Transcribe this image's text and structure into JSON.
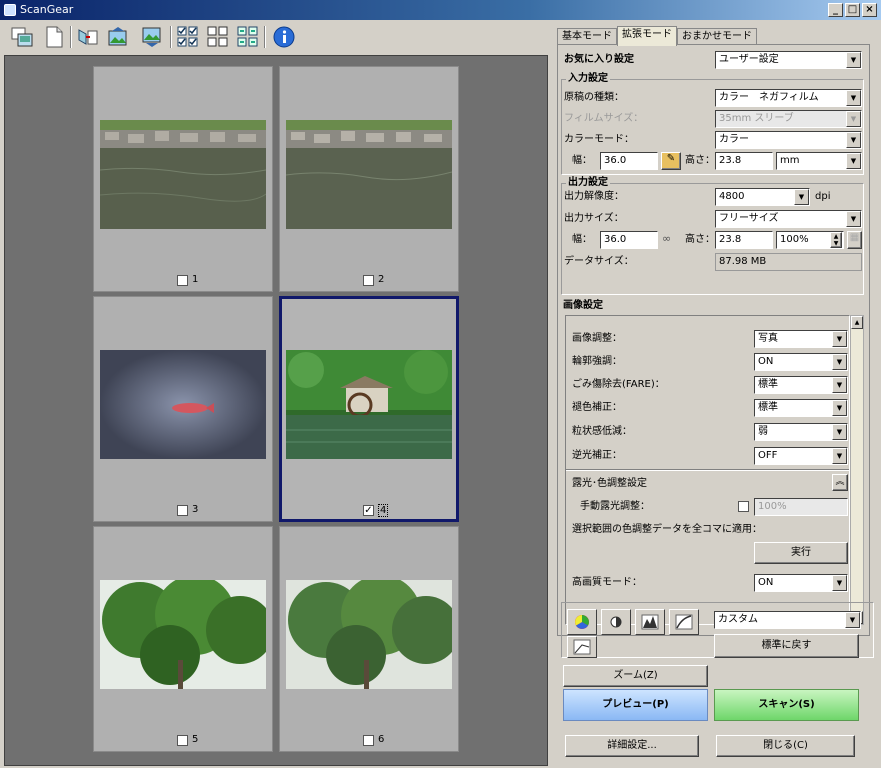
{
  "window": {
    "title": "ScanGear",
    "min": "_",
    "max": "□",
    "close": "×"
  },
  "toolbar": {
    "icons": [
      "multi-crop-icon",
      "blank-page-icon",
      "rotate-icon",
      "image-prev-icon",
      "image-next-icon",
      "checklist-icon",
      "grid-view-icon",
      "grid-view-alt-icon",
      "info-icon"
    ]
  },
  "thumbnails": [
    {
      "num": "1",
      "checked": false,
      "selected": false
    },
    {
      "num": "2",
      "checked": false,
      "selected": false
    },
    {
      "num": "3",
      "checked": false,
      "selected": false
    },
    {
      "num": "4",
      "checked": true,
      "selected": true
    },
    {
      "num": "5",
      "checked": false,
      "selected": false
    },
    {
      "num": "6",
      "checked": false,
      "selected": false
    }
  ],
  "tabs": {
    "basic": "基本モード",
    "advanced": "拡張モード",
    "auto": "おまかせモード"
  },
  "favorites": {
    "label": "お気に入り設定",
    "value": "ユーザー設定"
  },
  "input": {
    "title": "入力設定",
    "doc_type_label": "原稿の種類：",
    "doc_type_value": "カラー　ネガフィルム",
    "film_size_label": "フィルムサイズ：",
    "film_size_value": "35mm スリーブ",
    "color_mode_label": "カラーモード：",
    "color_mode_value": "カラー",
    "width_label": "幅：",
    "width_value": "36.0",
    "height_label": "高さ：",
    "height_value": "23.8",
    "unit": "mm"
  },
  "output": {
    "title": "出力設定",
    "resolution_label": "出力解像度：",
    "resolution_value": "4800",
    "resolution_unit": "dpi",
    "size_label": "出力サイズ：",
    "size_value": "フリーサイズ",
    "width_label": "幅：",
    "width_value": "36.0",
    "height_label": "高さ：",
    "height_value": "23.8",
    "scale": "100%",
    "data_size_label": "データサイズ：",
    "data_size_value": "87.98 MB"
  },
  "image": {
    "title": "画像設定",
    "adjust_label": "画像調整：",
    "adjust_value": "写真",
    "sharpen_label": "輪郭強調：",
    "sharpen_value": "ON",
    "fare_label": "ごみ傷除去(FARE)：",
    "fare_value": "標準",
    "fade_label": "褪色補正：",
    "fade_value": "標準",
    "grain_label": "粒状感低減：",
    "grain_value": "弱",
    "backlight_label": "逆光補正：",
    "backlight_value": "OFF",
    "exposure_title": "露光･色調整設定",
    "manual_exposure_label": "手動露光調整：",
    "manual_exposure_value": "100%",
    "apply_all_label": "選択範囲の色調整データを全コマに適用：",
    "run_button": "実行",
    "hq_label": "高画質モード：",
    "hq_value": "ON"
  },
  "color_tools": {
    "preset_value": "カスタム",
    "reset_button": "標準に戻す"
  },
  "buttons": {
    "zoom": "ズーム(Z)",
    "preview": "プレビュー(P)",
    "scan": "スキャン(S)",
    "preferences": "詳細設定...",
    "close": "閉じる(C)"
  }
}
